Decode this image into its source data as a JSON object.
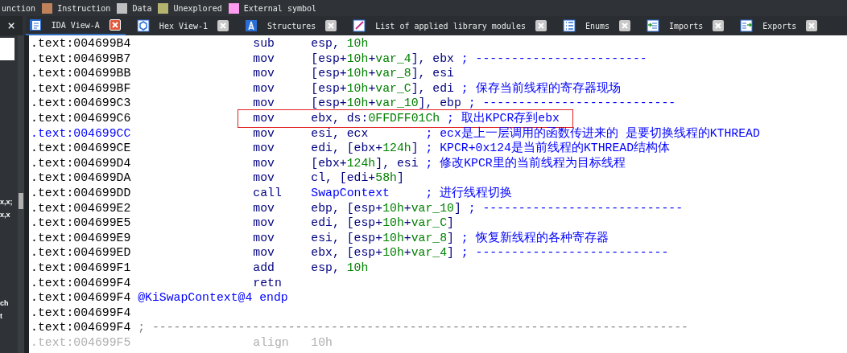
{
  "legend": [
    {
      "label": "unction"
    },
    {
      "label": "Instruction",
      "color": "#c0825a"
    },
    {
      "label": "Data",
      "color": "#c0c0c0"
    },
    {
      "label": "Unexplored",
      "color": "#b4b46e"
    },
    {
      "label": "External symbol",
      "color": "#ff9bf0"
    }
  ],
  "side_close": "×",
  "sidebar_fragments": [
    {
      "text": "x,x;"
    },
    {
      "text": "x,x"
    },
    {
      "text": "ch"
    },
    {
      "text": "t"
    }
  ],
  "tabs": [
    {
      "label": "IDA View-A",
      "kind": "listing",
      "selected": true
    },
    {
      "label": "Hex View-1",
      "kind": "hex",
      "selected": false
    },
    {
      "label": "Structures",
      "kind": "struct",
      "selected": false
    },
    {
      "label": "List of applied library modules",
      "kind": "library",
      "selected": false
    },
    {
      "label": "Enums",
      "kind": "enum",
      "selected": false
    },
    {
      "label": "Imports",
      "kind": "import",
      "selected": false
    },
    {
      "label": "Exports",
      "kind": "export",
      "selected": false
    }
  ],
  "lines": [
    {
      "kind": "insn",
      "address": ".text:004699B4",
      "mnemonic": "sub",
      "operands": [
        {
          "t": "esp, ",
          "kind": "register"
        },
        {
          "t": "10h",
          "kind": "number"
        }
      ]
    },
    {
      "kind": "insn",
      "address": ".text:004699B7",
      "mnemonic": "mov",
      "operands": [
        {
          "t": "[esp+",
          "kind": "register"
        },
        {
          "t": "10h",
          "kind": "number"
        },
        {
          "t": "+",
          "kind": "register"
        },
        {
          "t": "var_4",
          "kind": "number"
        },
        {
          "t": "], ebx",
          "kind": "register"
        }
      ],
      "comment": "; ------------------------"
    },
    {
      "kind": "insn",
      "address": ".text:004699BB",
      "mnemonic": "mov",
      "operands": [
        {
          "t": "[esp+",
          "kind": "register"
        },
        {
          "t": "10h",
          "kind": "number"
        },
        {
          "t": "+",
          "kind": "register"
        },
        {
          "t": "var_8",
          "kind": "number"
        },
        {
          "t": "], esi",
          "kind": "register"
        }
      ]
    },
    {
      "kind": "insn",
      "address": ".text:004699BF",
      "mnemonic": "mov",
      "operands": [
        {
          "t": "[esp+",
          "kind": "register"
        },
        {
          "t": "10h",
          "kind": "number"
        },
        {
          "t": "+",
          "kind": "register"
        },
        {
          "t": "var_C",
          "kind": "number"
        },
        {
          "t": "], edi",
          "kind": "register"
        }
      ],
      "comment": "; 保存当前线程的寄存器现场"
    },
    {
      "kind": "insn",
      "address": ".text:004699C3",
      "mnemonic": "mov",
      "operands": [
        {
          "t": "[esp+",
          "kind": "register"
        },
        {
          "t": "10h",
          "kind": "number"
        },
        {
          "t": "+",
          "kind": "register"
        },
        {
          "t": "var_10",
          "kind": "number"
        },
        {
          "t": "], ebp",
          "kind": "register"
        }
      ],
      "comment": "; ---------------------------"
    },
    {
      "kind": "insn",
      "address": ".text:004699C6",
      "mnemonic": "mov",
      "highlighted": true,
      "operands": [
        {
          "t": "ebx, ds:",
          "kind": "register"
        },
        {
          "t": "0FFDFF01Ch",
          "kind": "number"
        }
      ],
      "comment": "; 取出KPCR存到ebx"
    },
    {
      "kind": "insn",
      "address": ".text:004699CC",
      "mnemonic": "mov",
      "current": true,
      "operands": [
        {
          "t": "esi, ecx",
          "kind": "register"
        }
      ],
      "comment": "; ecx是上一层调用的函数传进来的 是要切换线程的KTHREAD"
    },
    {
      "kind": "insn",
      "address": ".text:004699CE",
      "mnemonic": "mov",
      "operands": [
        {
          "t": "edi, [ebx+",
          "kind": "register"
        },
        {
          "t": "124h",
          "kind": "number"
        },
        {
          "t": "]",
          "kind": "register"
        }
      ],
      "comment": "; KPCR+0x124是当前线程的KTHREAD结构体"
    },
    {
      "kind": "insn",
      "address": ".text:004699D4",
      "mnemonic": "mov",
      "operands": [
        {
          "t": "[ebx+",
          "kind": "register"
        },
        {
          "t": "124h",
          "kind": "number"
        },
        {
          "t": "], esi",
          "kind": "register"
        }
      ],
      "comment": "; 修改KPCR里的当前线程为目标线程"
    },
    {
      "kind": "insn",
      "address": ".text:004699DA",
      "mnemonic": "mov",
      "operands": [
        {
          "t": "cl, [edi+",
          "kind": "register"
        },
        {
          "t": "58h",
          "kind": "number"
        },
        {
          "t": "]",
          "kind": "register"
        }
      ]
    },
    {
      "kind": "insn",
      "address": ".text:004699DD",
      "mnemonic": "call",
      "operands": [
        {
          "t": "SwapContext",
          "kind": "symbol"
        }
      ],
      "comment": "; 进行线程切换"
    },
    {
      "kind": "insn",
      "address": ".text:004699E2",
      "mnemonic": "mov",
      "operands": [
        {
          "t": "ebp, [esp+",
          "kind": "register"
        },
        {
          "t": "10h",
          "kind": "number"
        },
        {
          "t": "+",
          "kind": "register"
        },
        {
          "t": "var_10",
          "kind": "number"
        },
        {
          "t": "]",
          "kind": "register"
        }
      ],
      "comment": "; ----------------------------"
    },
    {
      "kind": "insn",
      "address": ".text:004699E5",
      "mnemonic": "mov",
      "operands": [
        {
          "t": "edi, [esp+",
          "kind": "register"
        },
        {
          "t": "10h",
          "kind": "number"
        },
        {
          "t": "+",
          "kind": "register"
        },
        {
          "t": "var_C",
          "kind": "number"
        },
        {
          "t": "]",
          "kind": "register"
        }
      ]
    },
    {
      "kind": "insn",
      "address": ".text:004699E9",
      "mnemonic": "mov",
      "operands": [
        {
          "t": "esi, [esp+",
          "kind": "register"
        },
        {
          "t": "10h",
          "kind": "number"
        },
        {
          "t": "+",
          "kind": "register"
        },
        {
          "t": "var_8",
          "kind": "number"
        },
        {
          "t": "]",
          "kind": "register"
        }
      ],
      "comment": "; 恢复新线程的各种寄存器"
    },
    {
      "kind": "insn",
      "address": ".text:004699ED",
      "mnemonic": "mov",
      "operands": [
        {
          "t": "ebx, [esp+",
          "kind": "register"
        },
        {
          "t": "10h",
          "kind": "number"
        },
        {
          "t": "+",
          "kind": "register"
        },
        {
          "t": "var_4",
          "kind": "number"
        },
        {
          "t": "]",
          "kind": "register"
        }
      ],
      "comment": "; ---------------------------"
    },
    {
      "kind": "insn",
      "address": ".text:004699F1",
      "mnemonic": "add",
      "operands": [
        {
          "t": "esp, ",
          "kind": "register"
        },
        {
          "t": "10h",
          "kind": "number"
        }
      ]
    },
    {
      "kind": "insn",
      "address": ".text:004699F4",
      "mnemonic": "retn"
    },
    {
      "kind": "label",
      "address": ".text:004699F4",
      "text": "@KiSwapContext@4 endp"
    },
    {
      "kind": "blank",
      "address": ".text:004699F4"
    },
    {
      "kind": "separator",
      "address": ".text:004699F4",
      "text": "; ---------------------------------------------------------------------------"
    },
    {
      "kind": "insn",
      "address": ".text:004699F5",
      "mnemonic": "align",
      "dimmed": true,
      "operands": [
        {
          "t": "10h",
          "kind": "number"
        }
      ]
    }
  ]
}
